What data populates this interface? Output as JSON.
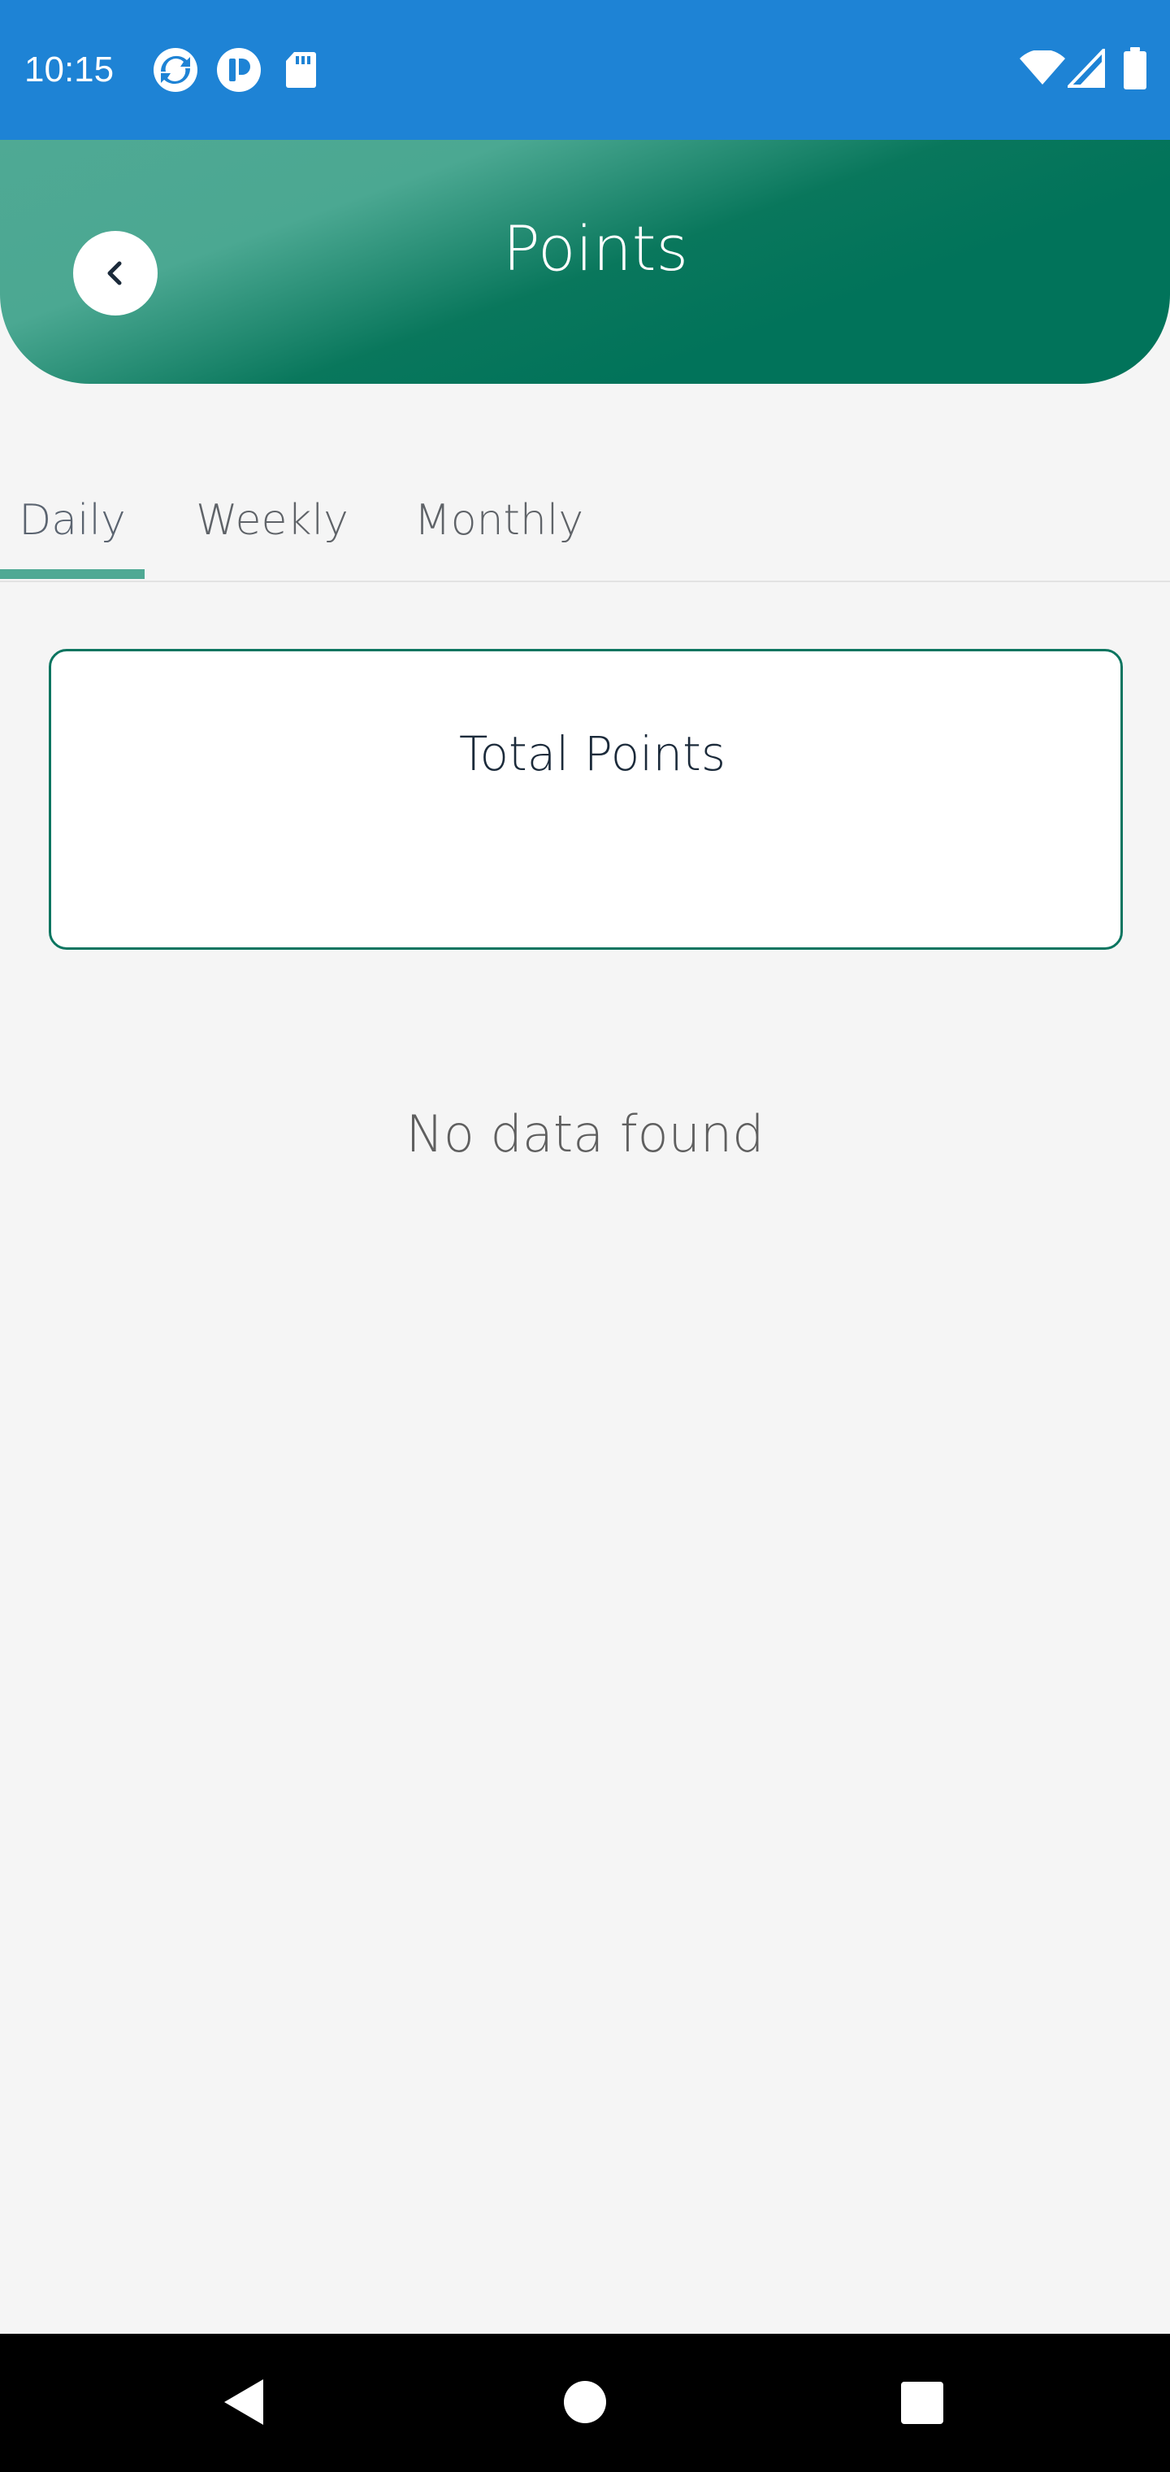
{
  "status_bar": {
    "time": "10:15",
    "left_icons": [
      "sync-icon",
      "app-icon",
      "sd-card-icon"
    ],
    "right_icons": [
      "wifi-icon",
      "signal-icon",
      "battery-icon"
    ],
    "color": "#1e83d5"
  },
  "header": {
    "title": "Points",
    "back_icon": "chevron-left-icon",
    "gradient_colors": [
      "#4fa994",
      "#01735a"
    ]
  },
  "tabs": {
    "items": [
      {
        "label": "Daily",
        "selected": true
      },
      {
        "label": "Weekly",
        "selected": false
      },
      {
        "label": "Monthly",
        "selected": false
      }
    ],
    "indicator_color": "#4fa994"
  },
  "total_card": {
    "label": "Total Points",
    "value": "",
    "border_color": "#0b7560"
  },
  "empty_state": {
    "message": "No data found"
  },
  "nav_bar": {
    "buttons": [
      "back-triangle-icon",
      "home-circle-icon",
      "recents-square-icon"
    ]
  }
}
